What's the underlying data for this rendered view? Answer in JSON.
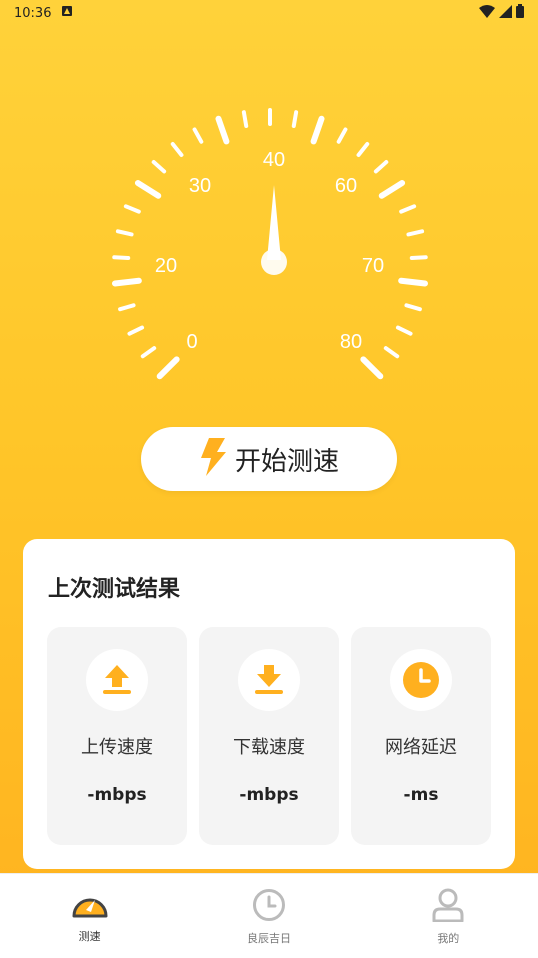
{
  "status_bar": {
    "time": "10:36"
  },
  "gauge": {
    "labels": [
      "0",
      "20",
      "30",
      "40",
      "60",
      "70",
      "80"
    ],
    "needle_value": 40
  },
  "start_button": {
    "label": "开始测速"
  },
  "result_card": {
    "title": "上次测试结果",
    "metrics": [
      {
        "name": "上传速度",
        "value": "-",
        "unit": "mbps"
      },
      {
        "name": "下载速度",
        "value": "-",
        "unit": "mbps"
      },
      {
        "name": "网络延迟",
        "value": "-",
        "unit": "ms"
      }
    ]
  },
  "bottom_nav": {
    "items": [
      {
        "label": "测速",
        "icon": "speedometer-icon",
        "active": true
      },
      {
        "label": "良辰吉日",
        "icon": "clock-icon",
        "active": false
      },
      {
        "label": "我的",
        "icon": "user-icon",
        "active": false
      }
    ]
  },
  "colors": {
    "accent": "#ffb21f",
    "accent_light": "#ffd23a",
    "icon_orange": "#ffb01f"
  }
}
